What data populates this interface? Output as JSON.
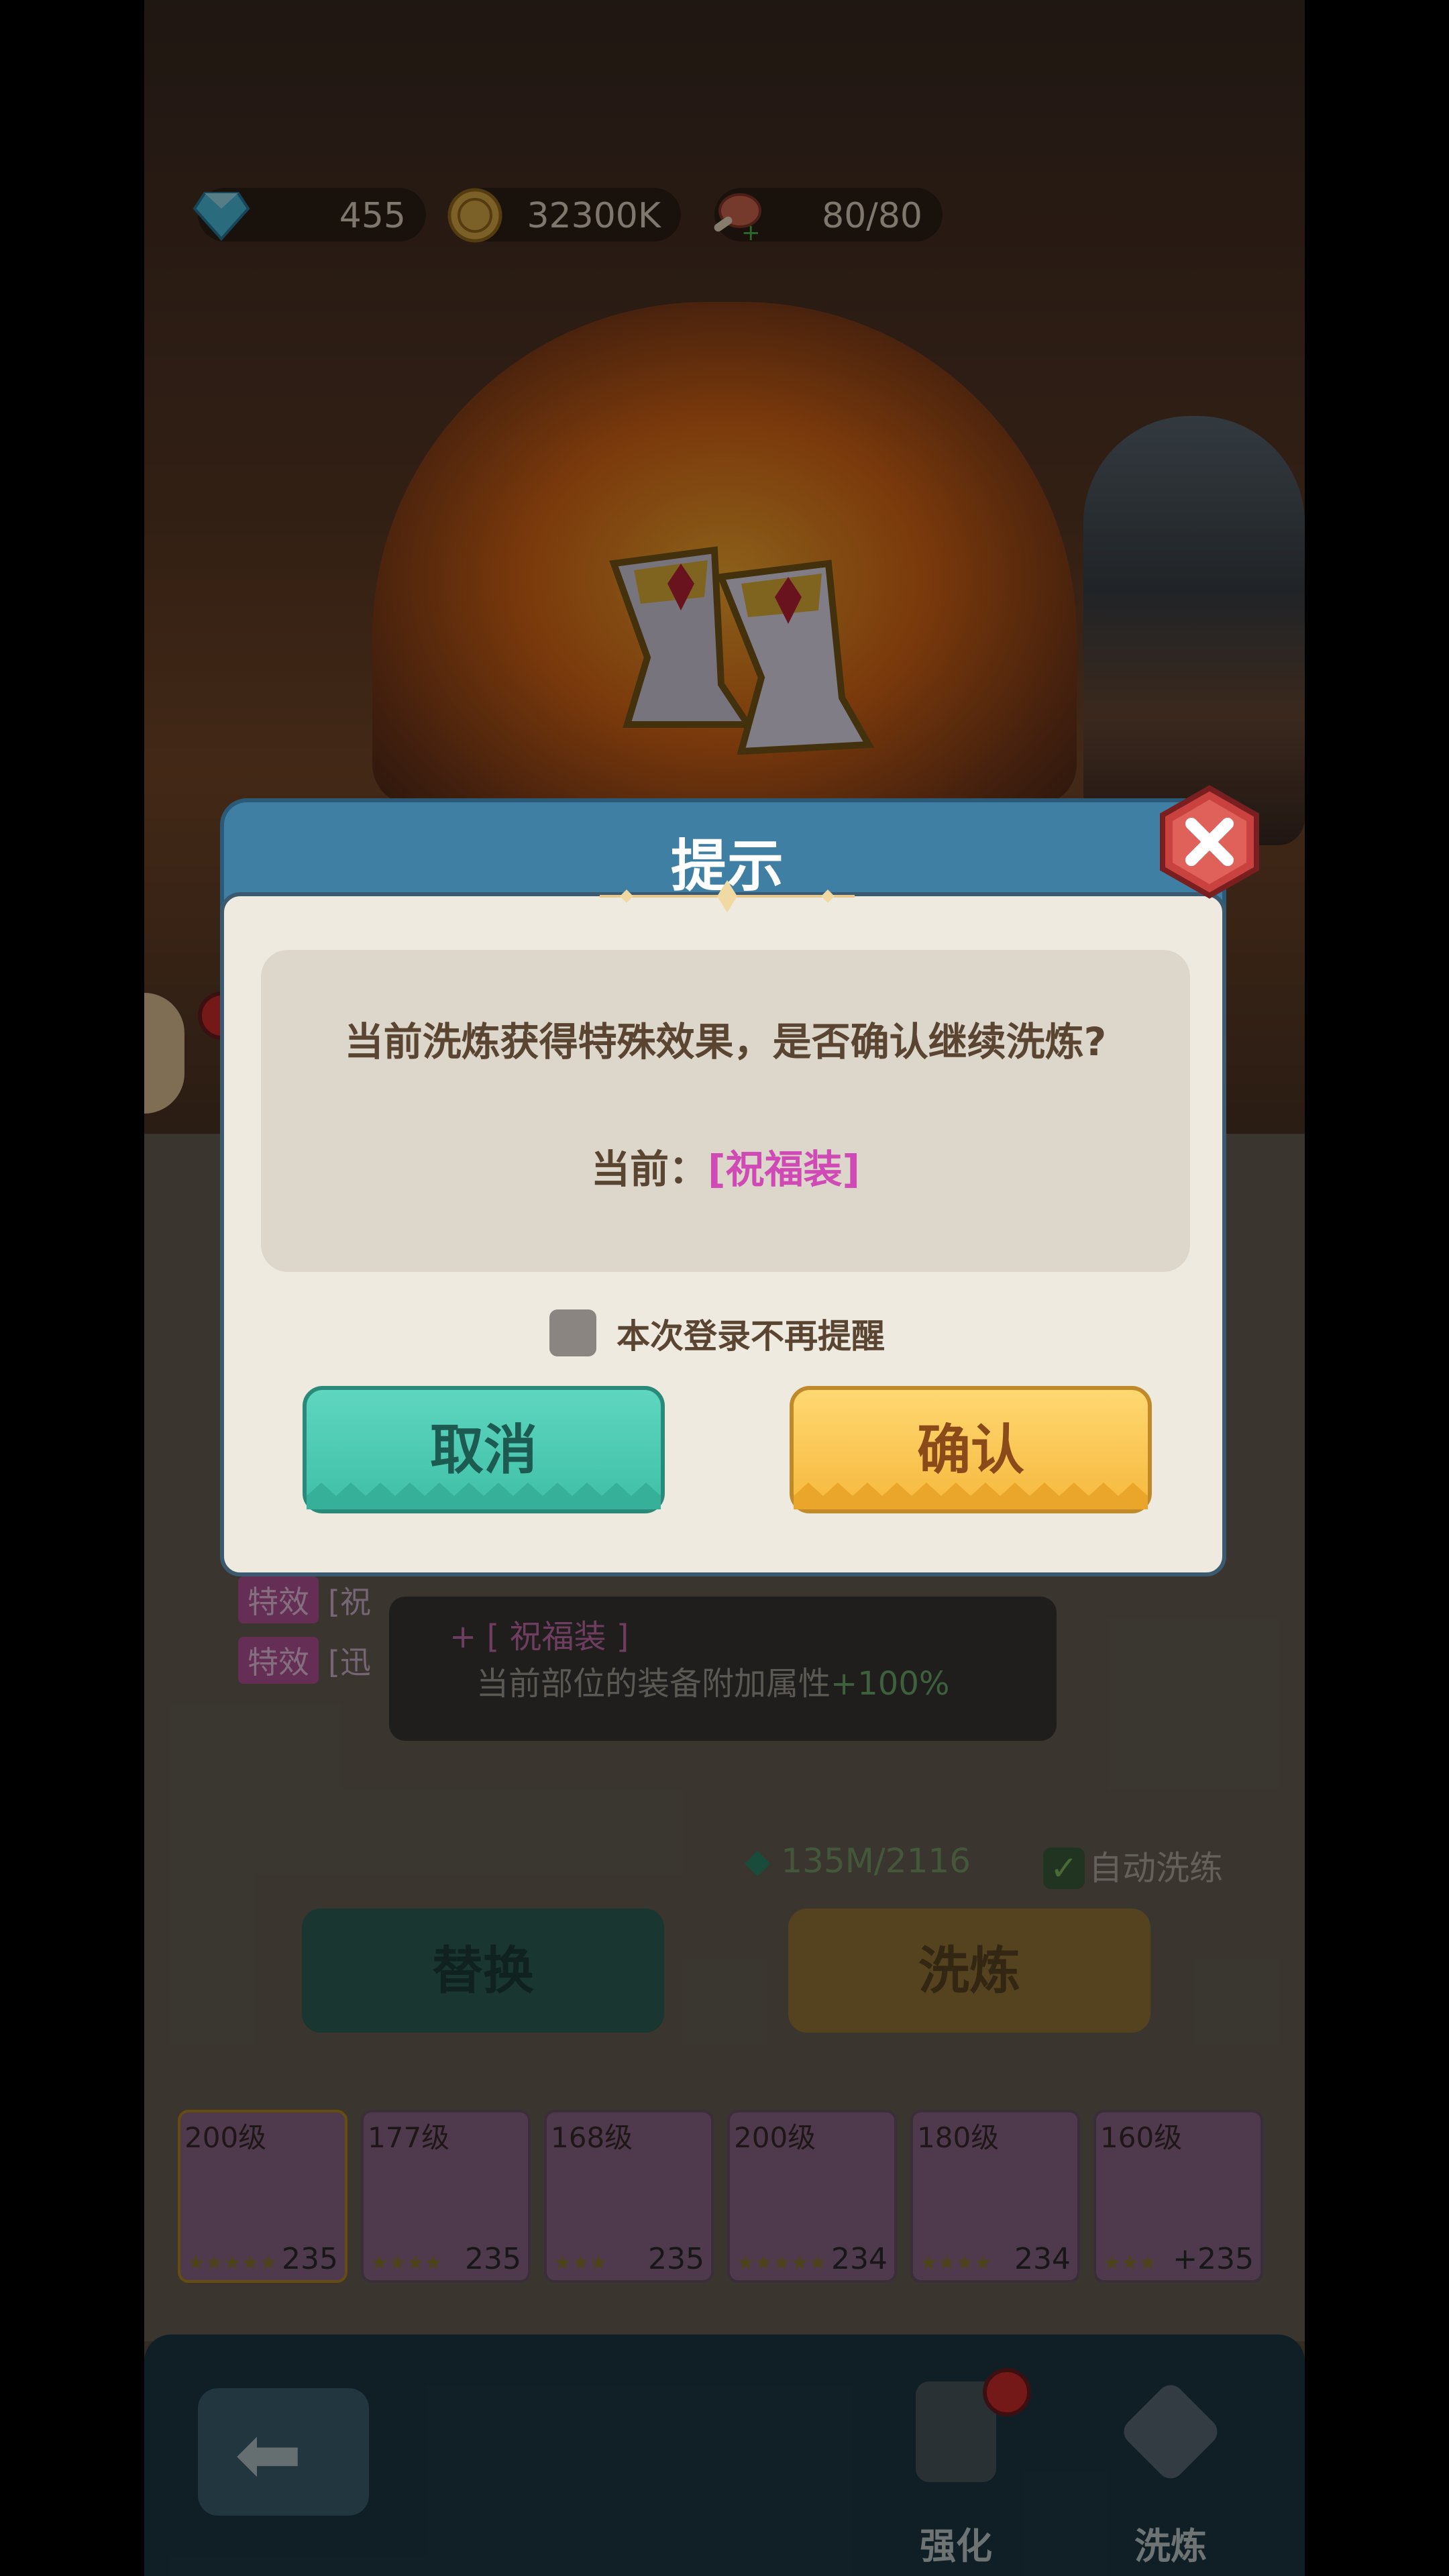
{
  "currency": {
    "diamonds": "455",
    "gold": "32300K",
    "stamina": "80/80"
  },
  "background": {
    "stat_tag": "特效",
    "stat_rows": [
      "[祝",
      "[迅"
    ],
    "tip_blessing": "+ [ 祝福装 ]",
    "tip_desc": "当前部位的装备附加属性",
    "tip_bonus": "+100%",
    "refine_count": "135M/2116",
    "auto_refine_label": "自动洗练",
    "replace_label": "替换",
    "refine_label": "洗炼"
  },
  "equipment": [
    {
      "level": "200级",
      "bonus": "235",
      "stars": "★★★★★"
    },
    {
      "level": "177级",
      "bonus": "235",
      "stars": "★★★★"
    },
    {
      "level": "168级",
      "bonus": "235",
      "stars": "★★★"
    },
    {
      "level": "200级",
      "bonus": "234",
      "stars": "★★★★★"
    },
    {
      "level": "180级",
      "bonus": "234",
      "stars": "★★★★"
    },
    {
      "level": "160级",
      "bonus": "+235",
      "stars": "★★★"
    }
  ],
  "nav": {
    "enhance_label": "强化",
    "refine_label": "洗炼"
  },
  "dialog": {
    "title": "提示",
    "message": "当前洗炼获得特殊效果，是否确认继续洗炼?",
    "current_prefix": "当前：",
    "current_value": "[祝福装]",
    "remember_label": "本次登录不再提醒",
    "cancel_label": "取消",
    "confirm_label": "确认"
  },
  "colors": {
    "dialog_header": "#3f7fa3",
    "cancel_button": "#4fcab2",
    "confirm_button": "#f8c34e",
    "effect_highlight": "#d04ab6"
  }
}
